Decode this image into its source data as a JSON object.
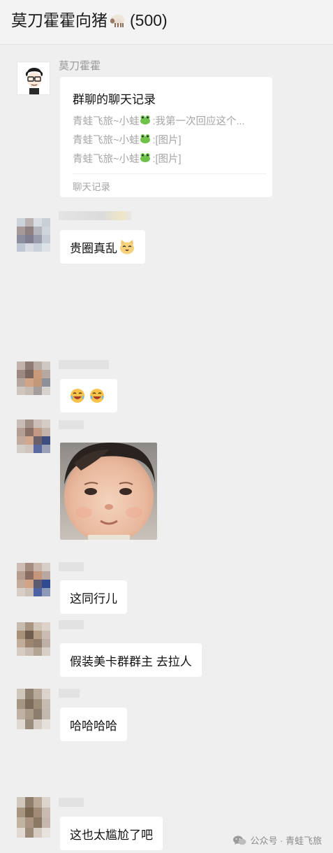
{
  "header": {
    "title": "莫刀霍霍向猪",
    "member_count": "(500)"
  },
  "messages": {
    "m1": {
      "sender": "莫刀霍霍",
      "card_title": "群聊的聊天记录",
      "lines": [
        {
          "name": "青蛙飞旅~小蛙",
          "text": ":我第一次回应这个..."
        },
        {
          "name": "青蛙飞旅~小蛙",
          "text": ":[图片]"
        },
        {
          "name": "青蛙飞旅~小蛙",
          "text": ":[图片]"
        }
      ],
      "card_footer": "聊天记录"
    },
    "m2": {
      "text": "贵圈真乱"
    },
    "m5": {
      "text": "这同行儿"
    },
    "m6": {
      "text": "假装美卡群群主 去拉人"
    },
    "m7": {
      "text": "哈哈哈哈"
    },
    "m8": {
      "text": "这也太尴尬了吧"
    }
  },
  "watermark": {
    "label": "公众号 · 青蛙飞旅"
  },
  "colors": {
    "background": "#efefef",
    "bubble": "#ffffff",
    "muted_text": "#a6a6a6"
  }
}
